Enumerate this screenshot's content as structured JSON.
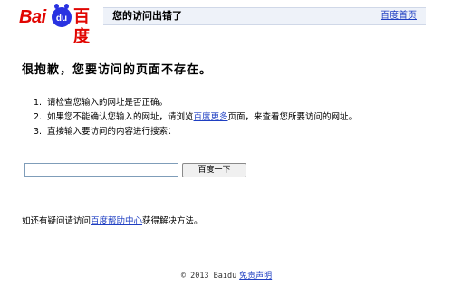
{
  "header": {
    "logo_latin": "Bai",
    "logo_paw": "du",
    "logo_cn": "百度",
    "title": "您的访问出错了",
    "home_link": "百度首页"
  },
  "main": {
    "heading": "很抱歉，您要访问的页面不存在。",
    "tips": [
      {
        "num": "1.",
        "text": "请检查您输入的网址是否正确。"
      },
      {
        "num": "2.",
        "before": "如果您不能确认您输入的网址，请浏览",
        "link": "百度更多",
        "after": "页面，来查看您所要访问的网址。"
      },
      {
        "num": "3.",
        "text": "直接输入要访问的内容进行搜索："
      }
    ],
    "search": {
      "value": "",
      "button_label": "百度一下"
    },
    "help": {
      "before": "如还有疑问请访问",
      "link": "百度帮助中心",
      "after": "获得解决方法。"
    }
  },
  "footer": {
    "copyright": "© 2013 Baidu",
    "disclaimer_link": "免责声明"
  },
  "colors": {
    "brand_red": "#e10602",
    "brand_blue": "#2932e1",
    "link": "#1f3fc2",
    "titlebar_bg": "#eef2f9"
  }
}
